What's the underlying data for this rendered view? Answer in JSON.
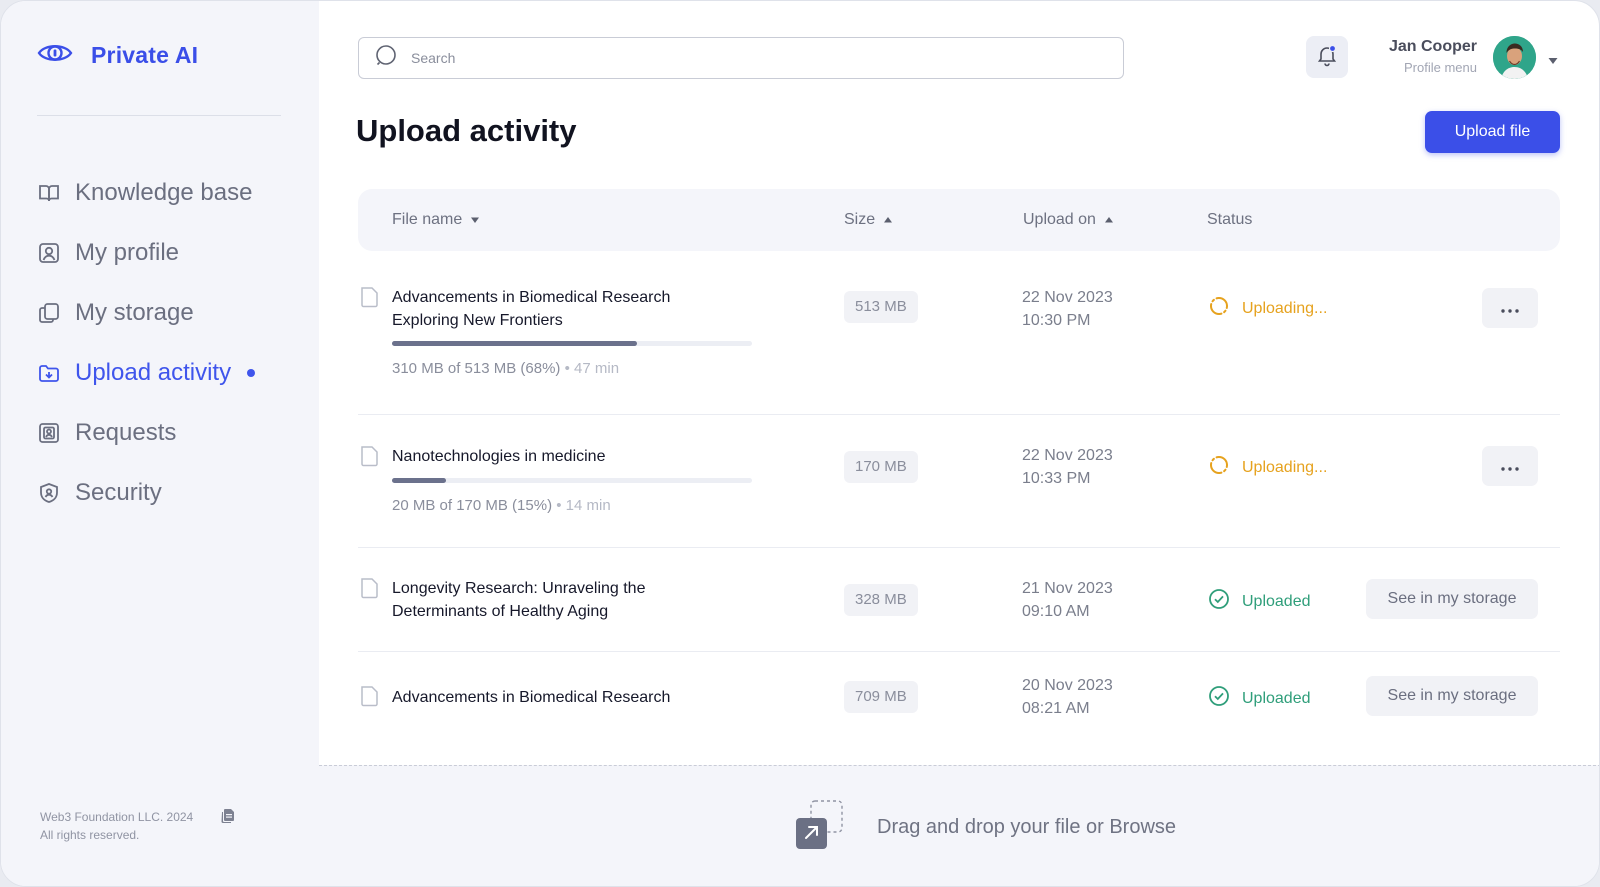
{
  "brand": {
    "name": "Private AI",
    "icon": "eye-icon",
    "accent": "#3b4fe8"
  },
  "sidebar": {
    "items": [
      {
        "label": "Knowledge base",
        "icon": "book-icon",
        "active": false
      },
      {
        "label": "My profile",
        "icon": "user-square-icon",
        "active": false
      },
      {
        "label": "My storage",
        "icon": "copy-icon",
        "active": false
      },
      {
        "label": "Upload activity",
        "icon": "upload-folder-icon",
        "active": true
      },
      {
        "label": "Requests",
        "icon": "contact-card-icon",
        "active": false
      },
      {
        "label": "Security",
        "icon": "shield-icon",
        "active": false
      }
    ],
    "footer_line1": "Web3 Foundation LLC. 2024",
    "footer_line2": "All rights reserved."
  },
  "header": {
    "search_placeholder": "Search",
    "profile_name": "Jan Cooper",
    "profile_sub": "Profile menu"
  },
  "page": {
    "title": "Upload activity",
    "upload_button": "Upload file"
  },
  "table": {
    "columns": [
      {
        "label": "File name",
        "sort": "desc"
      },
      {
        "label": "Size",
        "sort": "asc"
      },
      {
        "label": "Upload on",
        "sort": "asc"
      },
      {
        "label": "Status",
        "sort": ""
      }
    ],
    "rows": [
      {
        "name_line1": "Advancements in Biomedical Research",
        "name_line2": "Exploring New Frontiers",
        "progress": 0.68,
        "progress_text": "310 MB of 513 MB (68%)",
        "eta": "• 47 min",
        "size": "513 MB",
        "date": "22 Nov 2023",
        "time": "10:30 PM",
        "status": "Uploading...",
        "action": "more"
      },
      {
        "name_line1": "Nanotechnologies in medicine",
        "name_line2": "",
        "progress": 0.15,
        "progress_text": "20 MB of 170 MB (15%)",
        "eta": "• 14 min",
        "size": "170 MB",
        "date": "22 Nov 2023",
        "time": "10:33 PM",
        "status": "Uploading...",
        "action": "more"
      },
      {
        "name_line1": "Longevity Research: Unraveling the",
        "name_line2": "Determinants of Healthy Aging",
        "size": "328 MB",
        "date": "21 Nov 2023",
        "time": "09:10 AM",
        "status": "Uploaded",
        "action_label": "See in my storage"
      },
      {
        "name_line1": "Advancements in Biomedical Research",
        "name_line2": "",
        "size": "709 MB",
        "date": "20 Nov 2023",
        "time": "08:21 AM",
        "status": "Uploaded",
        "action_label": "See in my storage"
      }
    ]
  },
  "dropzone": {
    "text": "Drag and drop your file or Browse"
  },
  "colors": {
    "uploading": "#e6a21e",
    "uploaded": "#2f9e7a",
    "primary": "#3b4fe8"
  }
}
